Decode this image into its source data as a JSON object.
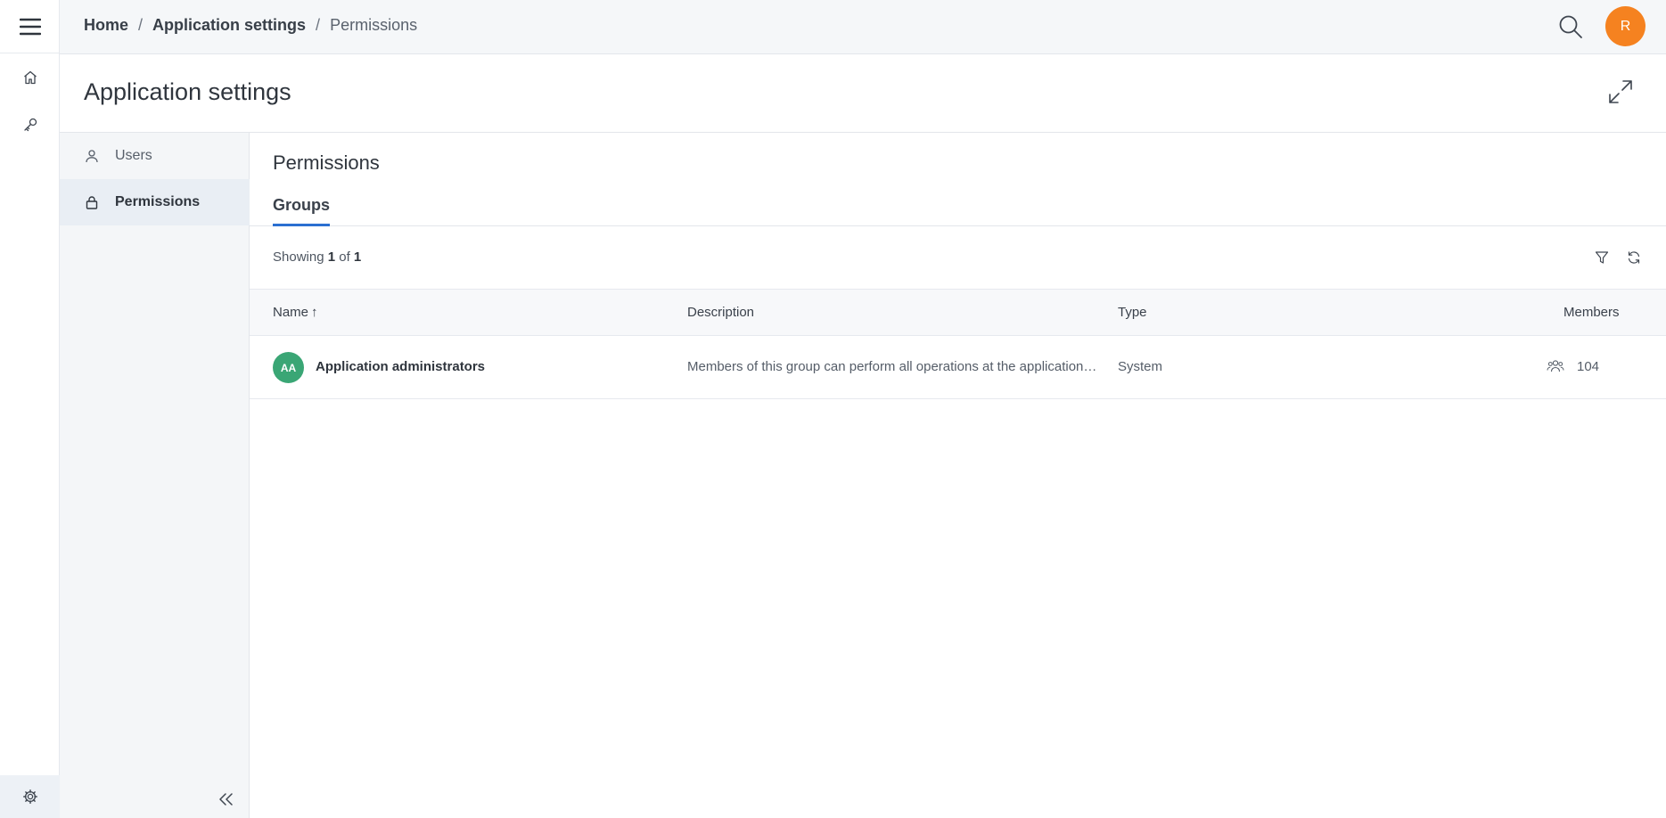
{
  "rail": {
    "icons": [
      "menu-icon",
      "home-icon",
      "key-icon",
      "gear-icon"
    ]
  },
  "breadcrumb": {
    "items": [
      "Home",
      "Application settings"
    ],
    "separator": "/",
    "current": "Permissions"
  },
  "user": {
    "initial": "R",
    "color": "#f58220"
  },
  "page": {
    "title": "Application settings"
  },
  "subnav": {
    "items": [
      {
        "label": "Users",
        "icon": "user-icon"
      },
      {
        "label": "Permissions",
        "icon": "lock-icon",
        "active": true
      }
    ]
  },
  "main": {
    "section_title": "Permissions",
    "tabs": [
      {
        "label": "Groups",
        "active": true
      }
    ],
    "showing": {
      "prefix": "Showing",
      "count": "1",
      "middle": "of",
      "total": "1"
    }
  },
  "table": {
    "columns": {
      "name": "Name",
      "description": "Description",
      "type": "Type",
      "members": "Members"
    },
    "sort_indicator": "↑",
    "rows": [
      {
        "initials": "AA",
        "avatar_color": "#3aa675",
        "name": "Application administrators",
        "description": "Members of this group can perform all operations at the application level",
        "type": "System",
        "members": "104"
      }
    ]
  },
  "colors": {
    "accent": "#2b6fd1"
  }
}
